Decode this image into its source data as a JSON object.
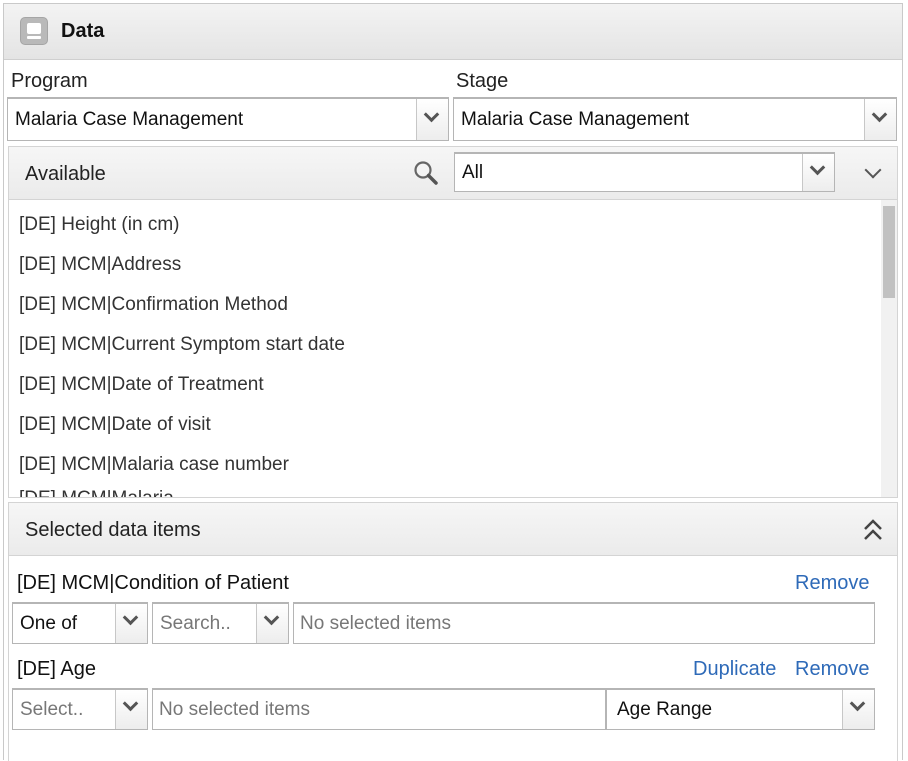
{
  "header": {
    "title": "Data",
    "icon": "monitor-icon"
  },
  "program": {
    "label": "Program",
    "value": "Malaria Case Management"
  },
  "stage": {
    "label": "Stage",
    "value": "Malaria Case Management"
  },
  "available": {
    "label": "Available",
    "filter_value": "All",
    "items": [
      "[DE] Height (in cm)",
      "[DE] MCM|Address",
      "[DE] MCM|Confirmation Method",
      "[DE] MCM|Current Symptom start date",
      "[DE] MCM|Date of Treatment",
      "[DE] MCM|Date of visit",
      "[DE] MCM|Malaria case number",
      "[DE] MCM|Malaria..."
    ]
  },
  "selected": {
    "label": "Selected data items",
    "items": [
      {
        "name": "[DE] MCM|Condition of Patient",
        "remove_label": "Remove",
        "operator": "One of",
        "search_placeholder": "Search..",
        "values_text": "No selected items"
      },
      {
        "name": "[DE] Age",
        "duplicate_label": "Duplicate",
        "remove_label": "Remove",
        "operator_placeholder": "Select..",
        "values_text": "No selected items",
        "legend_set": "Age Range"
      }
    ]
  }
}
